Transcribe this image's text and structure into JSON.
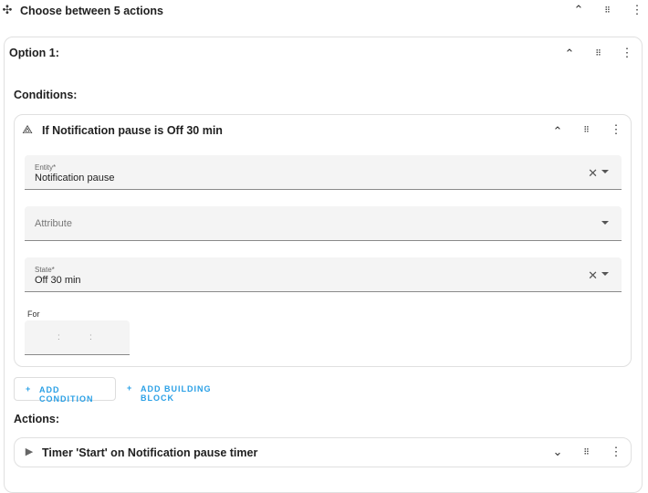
{
  "header": {
    "title": "Choose between 5 actions",
    "icon": "choose-icon"
  },
  "option": {
    "title": "Option 1:"
  },
  "conditions_label": "Conditions:",
  "condition": {
    "title": "If Notification pause is Off 30 min",
    "icon": "condition-icon",
    "entity": {
      "label": "Entity*",
      "value": "Notification pause"
    },
    "attribute": {
      "placeholder": "Attribute"
    },
    "state": {
      "label": "State*",
      "value": "Off 30 min"
    },
    "for": {
      "label": "For",
      "sep1": ":",
      "sep2": ":"
    }
  },
  "buttons": {
    "add_condition": "ADD CONDITION",
    "add_building_block": "ADD BUILDING BLOCK",
    "plus": "+"
  },
  "actions_label": "Actions:",
  "action": {
    "title": "Timer 'Start' on Notification pause timer"
  },
  "colors": {
    "accent": "#2aa0e6"
  }
}
